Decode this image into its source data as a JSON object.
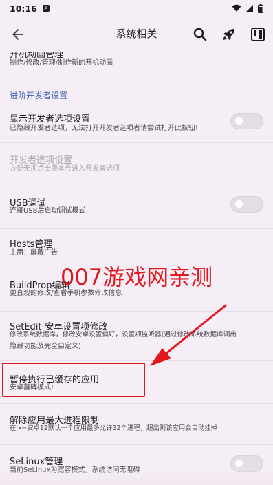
{
  "status": {
    "time": "10:16",
    "notif_letter": "A"
  },
  "app_bar": {
    "title": "系统相关"
  },
  "top_partial": {
    "title": "开机动画管理",
    "subtitle": "制作/修改/管理/制作新的开机动画"
  },
  "section_title": "进阶开发者设置",
  "items": [
    {
      "title": "显示开发者选项设置",
      "subtitle": "已隐藏开发者选项，无法打开开发者选项者请尝试打开此按钮!",
      "toggle": false
    },
    {
      "title": "开发者选项设置",
      "subtitle": "方便无须点击版本号进入开发者选项",
      "disabled": true
    },
    {
      "title": "USB调试",
      "subtitle": "连接USB后启动调试模式!",
      "toggle": false
    },
    {
      "title": "Hosts管理",
      "subtitle": "主用：屏蔽广告"
    },
    {
      "title": "BuildProp编辑",
      "subtitle": "更直观的修改/查看手机参数修改信息"
    },
    {
      "title": "SetEdit-安卓设置项修改",
      "subtitle": "修改系统数据库，修改安卓设置偏好，设置项监听器(通过修改系统数据库调出",
      "subtitle2": "隐藏功能及完全自定义)"
    },
    {
      "title": "暂停执行已缓存的应用",
      "subtitle": "安卓墓碑模式!"
    },
    {
      "title": "解除应用最大进程限制",
      "subtitle": "在>=安卓12默认一个应用最多允许32个进程，超出则该应用会自动挂掉"
    },
    {
      "title": "SeLinux管理",
      "subtitle": "当前SeLinux为宽容模式，系统访问无阻碍",
      "toggle": false
    }
  ],
  "watermark": "007游戏网亲测",
  "colors": {
    "accent_red": "#e2171d",
    "section_blue": "#3f66b8",
    "background": "#f6eef6"
  }
}
